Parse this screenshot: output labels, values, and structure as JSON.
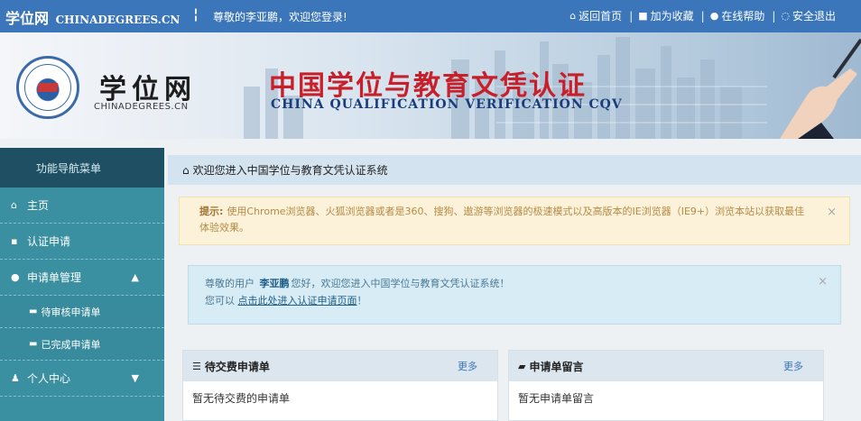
{
  "topbar": {
    "brand_cn": "学位网",
    "brand_en": "CHINADEGREES.CN",
    "separator": "¦",
    "greeting": "尊敬的李亚鹏，欢迎您登录!",
    "links": [
      {
        "icon": "home-icon",
        "glyph": "⌂",
        "label": "返回首页"
      },
      {
        "icon": "bookmark-icon",
        "glyph": "■",
        "label": "加为收藏"
      },
      {
        "icon": "help-icon",
        "glyph": "●",
        "label": "在线帮助"
      },
      {
        "icon": "logout-icon",
        "glyph": "◌",
        "label": "安全退出"
      }
    ]
  },
  "banner": {
    "logo_cn": "学位网",
    "logo_en": "CHINADEGREES.CN",
    "slogan_cn": "中国学位与教育文凭认证",
    "slogan_en": "CHINA QUALIFICATION VERIFICATION  CQV"
  },
  "sidebar": {
    "title": "功能导航菜单",
    "items": [
      {
        "label": "主页",
        "glyph": "⌂",
        "icon": "home-icon"
      },
      {
        "label": "认证申请",
        "glyph": "▪",
        "icon": "file-icon"
      },
      {
        "label": "申请单管理",
        "glyph": "●",
        "icon": "settings-icon",
        "chevron": "▲"
      },
      {
        "label": "待审核申请单",
        "glyph": "▬",
        "icon": "cart-icon",
        "sub": true
      },
      {
        "label": "已完成申请单",
        "glyph": "▬",
        "icon": "briefcase-icon",
        "sub": true
      },
      {
        "label": "个人中心",
        "glyph": "♟",
        "icon": "user-icon",
        "chevron": "▼"
      }
    ]
  },
  "main": {
    "header_icon": "⌂",
    "header": "欢迎您进入中国学位与教育文凭认证系统",
    "warning": {
      "label": "提示:",
      "text": "使用Chrome浏览器、火狐浏览器或者是360、搜狗、遨游等浏览器的极速模式以及高版本的IE浏览器（IE9+）浏览本站以获取最佳体验效果。",
      "close": "×"
    },
    "info": {
      "line1_prefix": "尊敬的用户",
      "name": "李亚鹏",
      "line1_suffix": "您好，欢迎您进入中国学位与教育文凭认证系统！",
      "line2_prefix": "您可以",
      "link": "点击此处进入认证申请页面",
      "line2_suffix": "！",
      "close": "×"
    },
    "panels": [
      {
        "icon": "list-icon",
        "glyph": "☰",
        "title": "待交费申请单",
        "more": "更多",
        "empty": "暂无待交费的申请单"
      },
      {
        "icon": "comment-icon",
        "glyph": "▰",
        "title": "申请单留言",
        "more": "更多",
        "empty": "暂无申请单留言"
      }
    ]
  }
}
